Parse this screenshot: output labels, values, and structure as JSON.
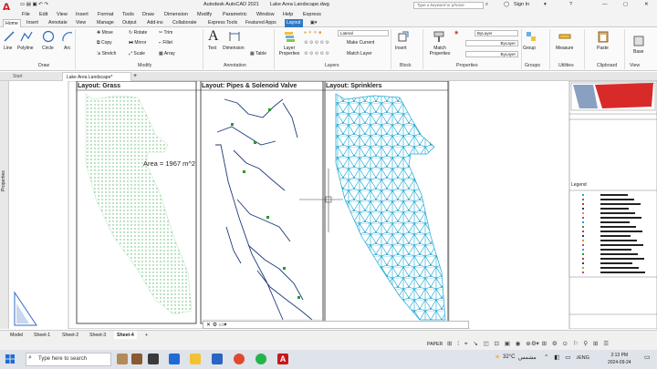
{
  "window": {
    "title": "Autodesk AutoCAD 2021",
    "file": "Lake Area Landscape.dwg",
    "search_placeholder": "Type a keyword or phrase",
    "sign_in": "Sign In"
  },
  "menu": [
    "File",
    "Edit",
    "View",
    "Insert",
    "Format",
    "Tools",
    "Draw",
    "Dimension",
    "Modify",
    "Parametric",
    "Window",
    "Help",
    "Express"
  ],
  "tabs": [
    "Home",
    "Insert",
    "Annotate",
    "View",
    "Manage",
    "Output",
    "Add-ins",
    "Collaborate",
    "Express Tools",
    "Featured Apps",
    "Layout"
  ],
  "ribbon": {
    "draw": {
      "label": "Draw",
      "items": [
        "Line",
        "Polyline",
        "Circle",
        "Arc"
      ]
    },
    "modify": {
      "label": "Modify",
      "items": [
        "Move",
        "Rotate",
        "Trim",
        "Copy",
        "Mirror",
        "Fillet",
        "Stretch",
        "Scale",
        "Array"
      ]
    },
    "annotation": {
      "label": "Annotation",
      "items": [
        "Text",
        "Dimension",
        "Table"
      ]
    },
    "layers": {
      "label": "Layers",
      "layer_properties": "Layer Properties",
      "current_layer": "Lateral",
      "make_current": "Make Current",
      "match_layer": "Match Layer"
    },
    "block": {
      "label": "Block",
      "insert": "Insert"
    },
    "properties": {
      "label": "Properties",
      "match": "Match Properties",
      "bylayer1": "ByLayer",
      "bylayer2": "ByLayer",
      "bylayer3": "ByLayer"
    },
    "groups": {
      "label": "Groups",
      "group": "Group"
    },
    "utilities": {
      "label": "Utilities",
      "measure": "Measure"
    },
    "clipboard": {
      "label": "Clipboard",
      "paste": "Paste"
    },
    "view": {
      "label": "View",
      "base": "Base"
    }
  },
  "file_tabs": {
    "start": "Start",
    "doc": "Lake Area Landscape*"
  },
  "side_panel": {
    "label": "Properties"
  },
  "layouts": [
    {
      "title": "Layout: Grass",
      "annotation": "Area = 1967 m^2"
    },
    {
      "title": "Layout: Pipes & Solenoid Valve"
    },
    {
      "title": "Layout: Sprinklers"
    }
  ],
  "legend_label": "Legend",
  "sheets": [
    "Model",
    "Sheet-1",
    "Sheet-2",
    "Sheet-3",
    "Sheet-4"
  ],
  "status": {
    "paper": "PAPER"
  },
  "taskbar": {
    "search": "Type here to search",
    "weather": "32°C",
    "weather_text": "مشمس",
    "lang": "ENG",
    "time": "2:13 PM",
    "date": "2024-09-24"
  },
  "colors": {
    "autocad_red": "#c8161d",
    "grass": "#5bb66a",
    "pipe": "#2a9a2a",
    "sprinkler": "#1aa9d6",
    "tab_highlight": "#2f79c6"
  }
}
